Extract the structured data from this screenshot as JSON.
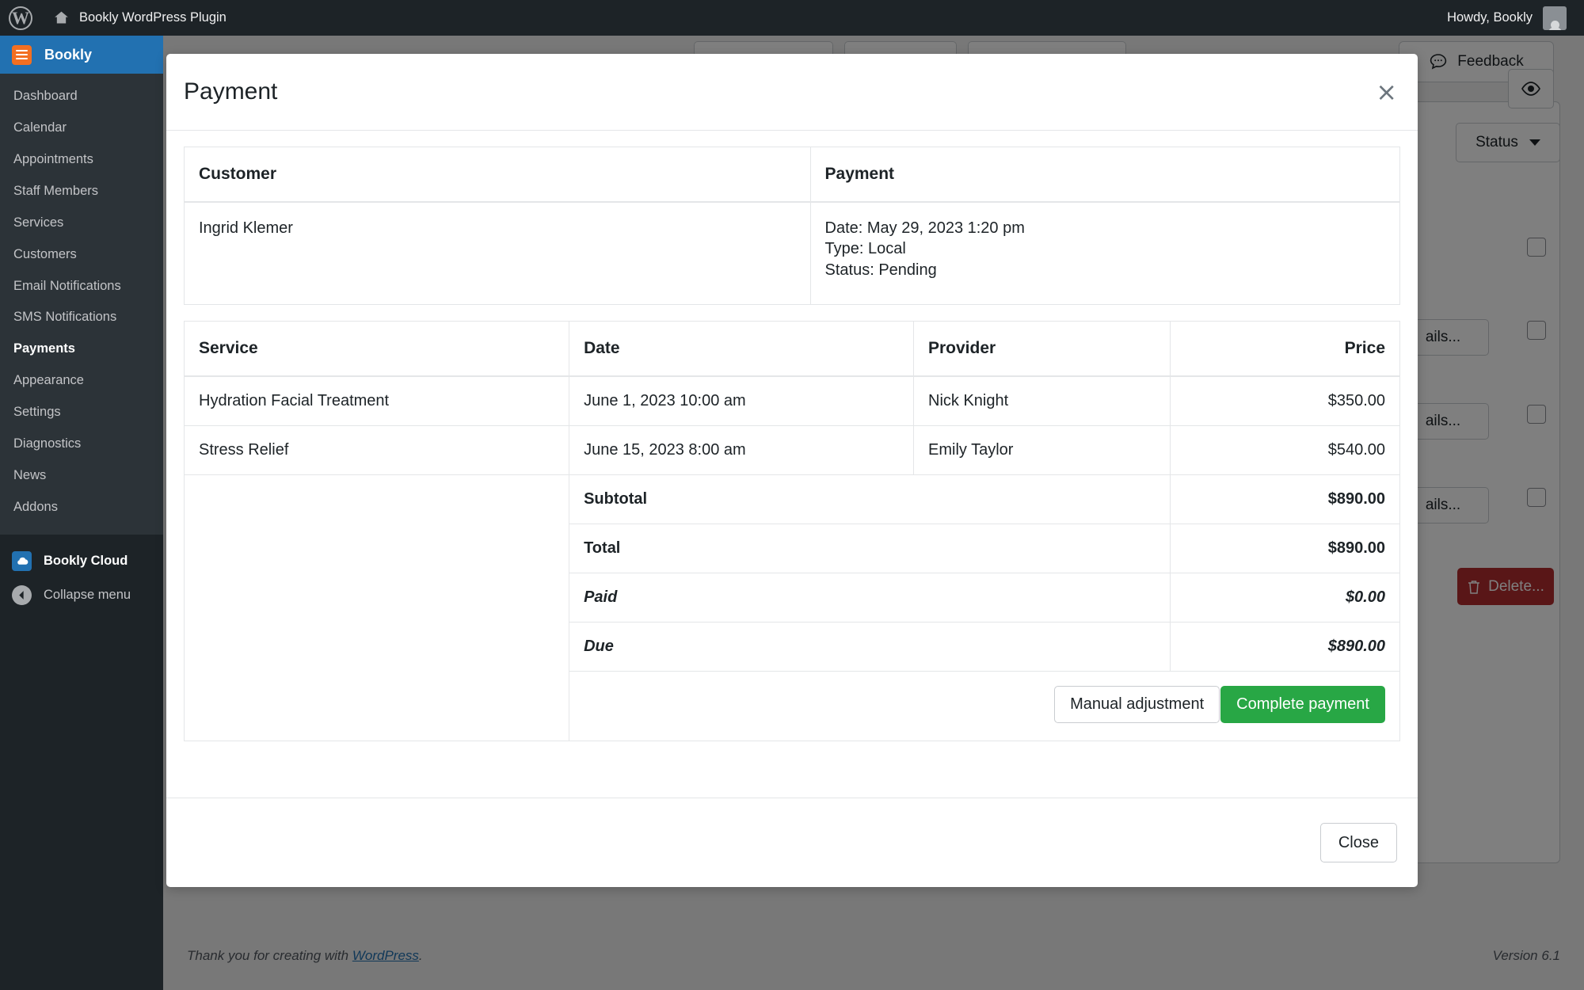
{
  "adminbar": {
    "wp_logo": "W",
    "site_title": "Bookly WordPress Plugin",
    "howdy": "Howdy, Bookly"
  },
  "sidebar": {
    "brand": "Bookly",
    "items": [
      {
        "label": "Dashboard",
        "active": false
      },
      {
        "label": "Calendar",
        "active": false
      },
      {
        "label": "Appointments",
        "active": false
      },
      {
        "label": "Staff Members",
        "active": false
      },
      {
        "label": "Services",
        "active": false
      },
      {
        "label": "Customers",
        "active": false
      },
      {
        "label": "Email Notifications",
        "active": false
      },
      {
        "label": "SMS Notifications",
        "active": false
      },
      {
        "label": "Payments",
        "active": true
      },
      {
        "label": "Appearance",
        "active": false
      },
      {
        "label": "Settings",
        "active": false
      },
      {
        "label": "Diagnostics",
        "active": false
      },
      {
        "label": "News",
        "active": false
      },
      {
        "label": "Addons",
        "active": false
      }
    ],
    "cloud_label": "Bookly Cloud",
    "collapse_label": "Collapse menu"
  },
  "page": {
    "feedback_label": "Feedback",
    "status_label": "Status",
    "details_label": "ails...",
    "delete_label": "Delete..."
  },
  "modal": {
    "title": "Payment",
    "close_icon": "×",
    "info": {
      "customer_header": "Customer",
      "payment_header": "Payment",
      "customer_name": "Ingrid Klemer",
      "payment_date": "Date: May 29, 2023 1:20 pm",
      "payment_type": "Type: Local",
      "payment_status": "Status: Pending"
    },
    "items": {
      "columns": [
        "Service",
        "Date",
        "Provider",
        "Price"
      ],
      "rows": [
        {
          "service": "Hydration Facial Treatment",
          "date": "June 1, 2023 10:00 am",
          "provider": "Nick Knight",
          "price": "$350.00"
        },
        {
          "service": "Stress Relief",
          "date": "June 15, 2023 8:00 am",
          "provider": "Emily Taylor",
          "price": "$540.00"
        }
      ],
      "totals": [
        {
          "label": "Subtotal",
          "value": "$890.00",
          "italic": false
        },
        {
          "label": "Total",
          "value": "$890.00",
          "italic": false
        },
        {
          "label": "Paid",
          "value": "$0.00",
          "italic": true
        },
        {
          "label": "Due",
          "value": "$890.00",
          "italic": true
        }
      ]
    },
    "buttons": {
      "manual_adjustment": "Manual adjustment",
      "complete_payment": "Complete payment",
      "close": "Close"
    },
    "colors": {
      "green": "#28a745",
      "blue": "#2271b1"
    }
  },
  "footer": {
    "thanks_prefix": "Thank you for creating with ",
    "wordpress_link": "WordPress",
    "thanks_suffix": ".",
    "version": "Version 6.1"
  }
}
